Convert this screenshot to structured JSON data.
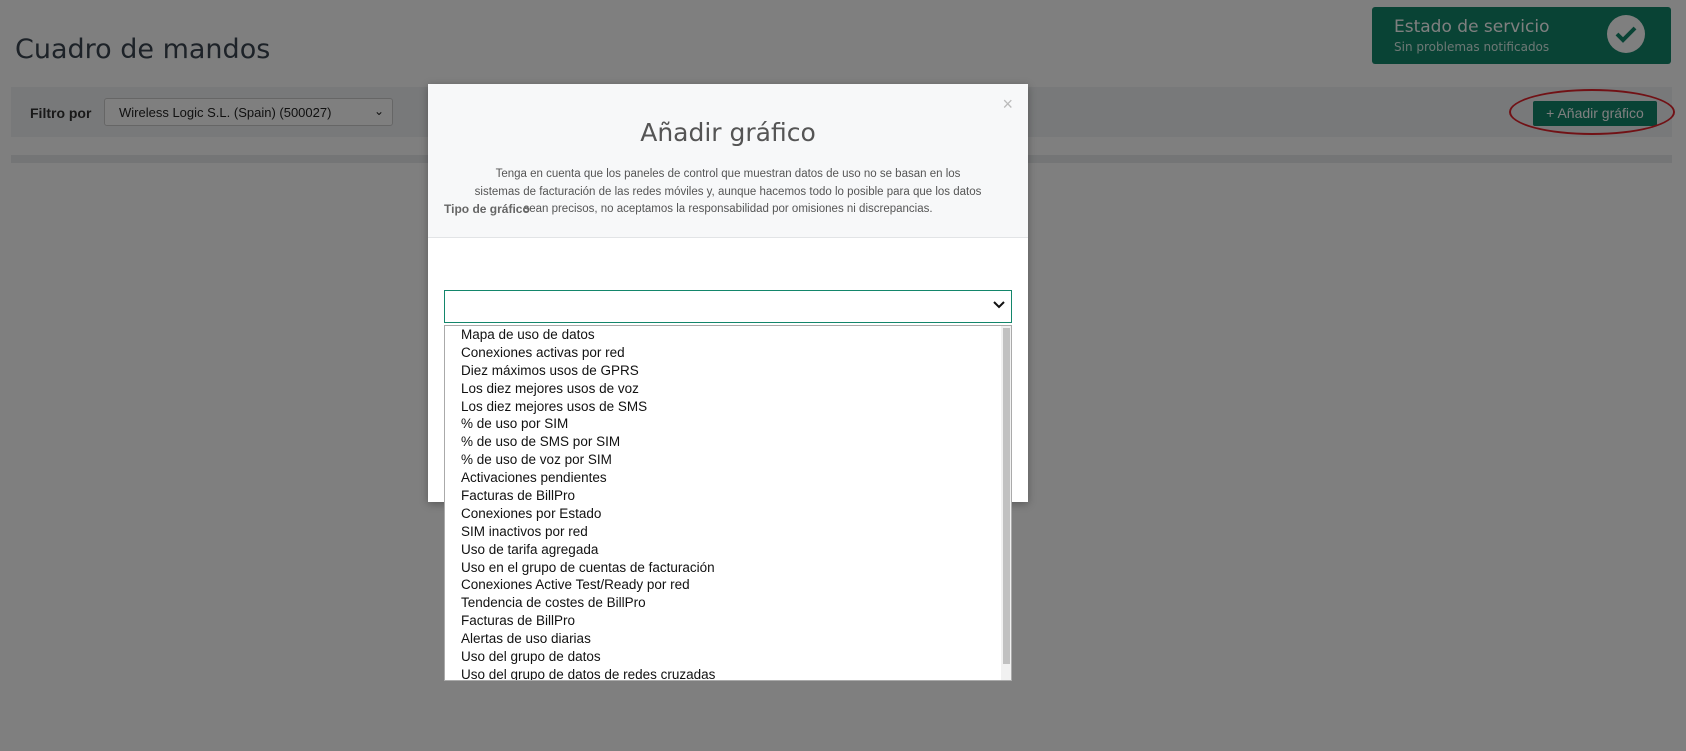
{
  "page": {
    "title": "Cuadro de mandos"
  },
  "service_status": {
    "title": "Estado de servicio",
    "subtitle": "Sin problemas notificados",
    "icon": "check-circle-icon"
  },
  "filter": {
    "label": "Filtro por",
    "selected": "Wireless Logic S.L. (Spain) (500027)"
  },
  "toolbar": {
    "add_chart_label": "+ Añadir gráfico"
  },
  "modal": {
    "close_label": "×",
    "title": "Añadir gráfico",
    "description": "Tenga en cuenta que los paneles de control que muestran datos de uso no se basan en los sistemas de facturación de las redes móviles y, aunque hacemos todo lo posible para que los datos sean precisos, no aceptamos la responsabilidad por omisiones ni discrepancias.",
    "field_label": "Tipo de gráfico",
    "selected_value": ""
  },
  "chart_type_options": [
    "Mapa de uso de datos",
    "Conexiones activas por red",
    "Diez máximos usos de GPRS",
    "Los diez mejores usos de voz",
    "Los diez mejores usos de SMS",
    "% de uso por SIM",
    "% de uso de SMS por SIM",
    "% de uso de voz por SIM",
    "Activaciones pendientes",
    "Facturas de BillPro",
    "Conexiones por Estado",
    "SIM inactivos por red",
    "Uso de tarifa agregada",
    "Uso en el grupo de cuentas de facturación",
    "Conexiones Active Test/Ready por red",
    "Tendencia de costes de BillPro",
    "Facturas de BillPro",
    "Alertas de uso diarias",
    "Uso del grupo de datos",
    "Uso del grupo de datos de redes cruzadas"
  ],
  "colors": {
    "brand": "#13866b",
    "highlight": "#e3222b"
  }
}
